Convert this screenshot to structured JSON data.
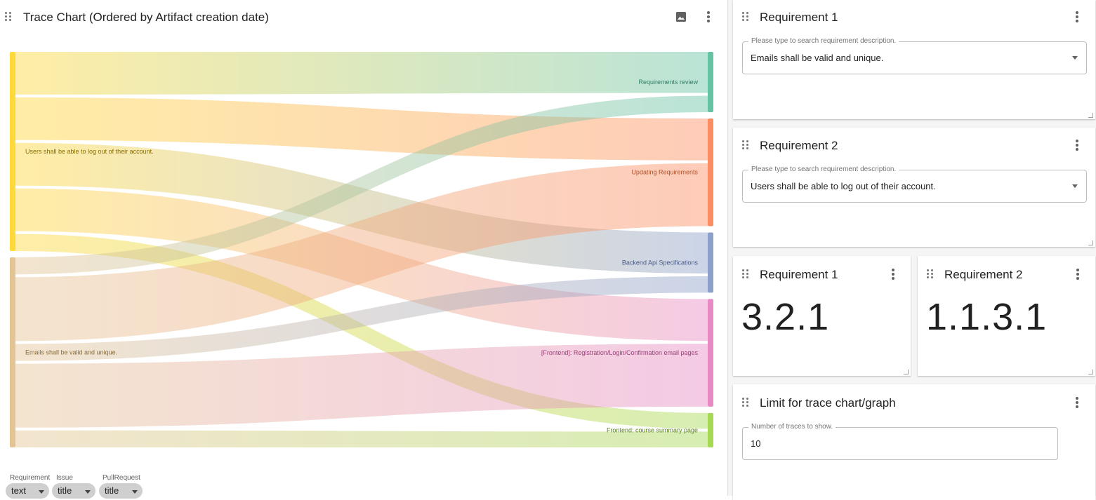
{
  "chart_panel": {
    "title": "Trace Chart (Ordered by Artifact creation date)",
    "image_icon": "image-icon",
    "menu_icon": "more-vert-icon"
  },
  "chart_data": {
    "type": "sankey",
    "nodes_left": [
      {
        "label": "Users shall be able to log out of their account.",
        "color": "#FFD83A"
      },
      {
        "label": "Emails shall be valid and unique.",
        "color": "#E5C494"
      }
    ],
    "nodes_right": [
      {
        "label": "Requirements review",
        "color": "#66C2A5"
      },
      {
        "label": "Updating Requirements",
        "color": "#FC8D62"
      },
      {
        "label": "Backend Api Specifications",
        "color": "#8DA0CB"
      },
      {
        "label": "[Frontend]: Registration/Login/Confirmation email pages",
        "color": "#E78AC3"
      },
      {
        "label": "Frontend: course summary page",
        "color": "#A6D854"
      }
    ],
    "links": [
      {
        "source": "Users shall be able to log out of their account.",
        "target": "Requirements review",
        "value": 1
      },
      {
        "source": "Users shall be able to log out of their account.",
        "target": "Updating Requirements",
        "value": 1
      },
      {
        "source": "Users shall be able to log out of their account.",
        "target": "Backend Api Specifications",
        "value": 1
      },
      {
        "source": "Users shall be able to log out of their account.",
        "target": "[Frontend]: Registration/Login/Confirmation email pages",
        "value": 1
      },
      {
        "source": "Users shall be able to log out of their account.",
        "target": "Frontend: course summary page",
        "value": 0.4
      },
      {
        "source": "Emails shall be valid and unique.",
        "target": "Requirements review",
        "value": 0.4
      },
      {
        "source": "Emails shall be valid and unique.",
        "target": "Updating Requirements",
        "value": 1.5
      },
      {
        "source": "Emails shall be valid and unique.",
        "target": "Backend Api Specifications",
        "value": 0.4
      },
      {
        "source": "Emails shall be valid and unique.",
        "target": "[Frontend]: Registration/Login/Confirmation email pages",
        "value": 1.5
      },
      {
        "source": "Emails shall be valid and unique.",
        "target": "Frontend: course summary page",
        "value": 0.4
      }
    ]
  },
  "chart_controls": [
    {
      "label": "Requirement",
      "value": "text"
    },
    {
      "label": "Issue",
      "value": "title"
    },
    {
      "label": "PullRequest",
      "value": "title"
    }
  ],
  "req1_card": {
    "title": "Requirement 1",
    "field_label": "Please type to search requirement description.",
    "field_value": "Emails shall be valid and unique."
  },
  "req2_card": {
    "title": "Requirement 2",
    "field_label": "Please type to search requirement description.",
    "field_value": "Users shall be able to log out of their account."
  },
  "req1_number": {
    "title": "Requirement 1",
    "value": "3.2.1"
  },
  "req2_number": {
    "title": "Requirement 2",
    "value": "1.1.3.1"
  },
  "limit_card": {
    "title": "Limit for trace chart/graph",
    "field_label": "Number of traces to show.",
    "field_value": "10"
  }
}
